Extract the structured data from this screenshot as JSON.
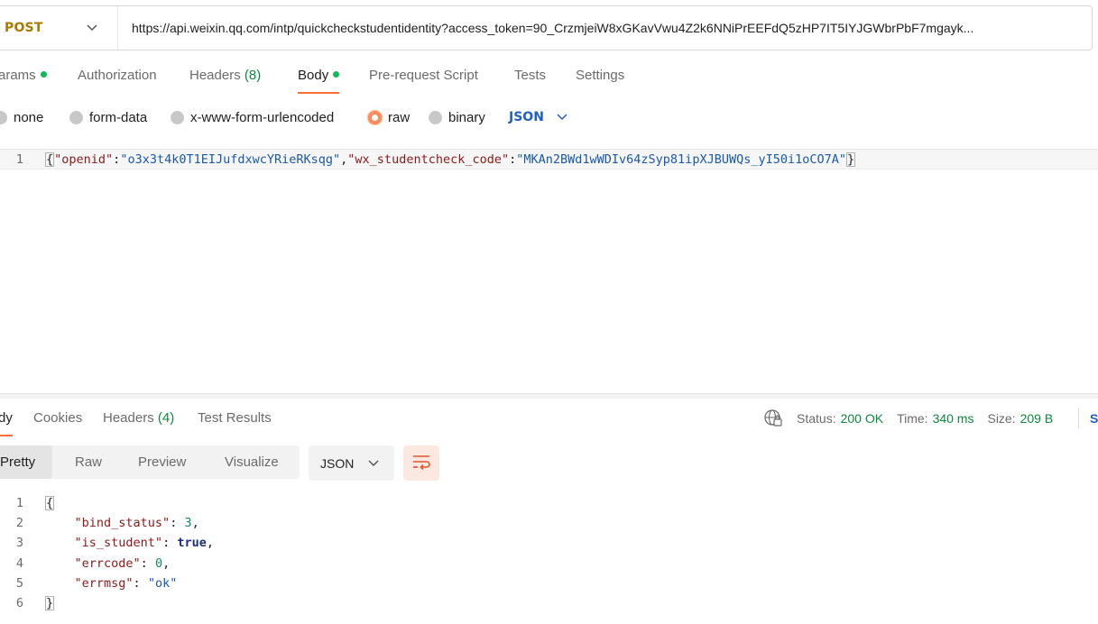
{
  "request": {
    "method": "POST",
    "url": "https://api.weixin.qq.com/intp/quickcheckstudentidentity?access_token=90_CrzmjeiW8xGKavVwu4Z2k6NNiPrEEFdQ5zHP7IT5IYJGWbrPbF7mgayk..."
  },
  "req_tabs": [
    {
      "label": "arams",
      "dot": true
    },
    {
      "label": "Authorization"
    },
    {
      "label": "Headers",
      "count": "(8)"
    },
    {
      "label": "Body",
      "dot": true,
      "active": true
    },
    {
      "label": "Pre-request Script"
    },
    {
      "label": "Tests"
    },
    {
      "label": "Settings"
    }
  ],
  "body_types": [
    {
      "label": "none"
    },
    {
      "label": "form-data"
    },
    {
      "label": "x-www-form-urlencoded"
    },
    {
      "label": "raw",
      "checked": true
    },
    {
      "label": "binary"
    }
  ],
  "body_format": "JSON",
  "request_body": {
    "line_number": "1",
    "open": "{",
    "key1": "\"openid\"",
    "colon": ":",
    "val1": "\"o3x3t4k0T1EIJufdxwcYRieRKsqg\"",
    "comma": ",",
    "key2": "\"wx_studentcheck_code\"",
    "val2": "\"MKAn2BWd1wWDIv64zSyp81ipXJBUWQs_yI50i1oCO7A\"",
    "close": "}"
  },
  "resp_tabs": [
    {
      "label": "dy",
      "active": true
    },
    {
      "label": "Cookies"
    },
    {
      "label": "Headers",
      "count": "(4)"
    },
    {
      "label": "Test Results"
    }
  ],
  "status": {
    "status_label": "Status:",
    "status_value": "200 OK",
    "time_label": "Time:",
    "time_value": "340 ms",
    "size_label": "Size:",
    "size_value": "209 B",
    "save_cut": "S"
  },
  "view_modes": [
    "Pretty",
    "Raw",
    "Preview",
    "Visualize"
  ],
  "response_format": "JSON",
  "response_lines": [
    {
      "n": "1",
      "text": "{"
    },
    {
      "n": "2",
      "key": "\"bind_status\"",
      "sep": ": ",
      "val": "3",
      "type": "num",
      "end": ","
    },
    {
      "n": "3",
      "key": "\"is_student\"",
      "sep": ": ",
      "val": "true",
      "type": "bool",
      "end": ","
    },
    {
      "n": "4",
      "key": "\"errcode\"",
      "sep": ": ",
      "val": "0",
      "type": "num",
      "end": ","
    },
    {
      "n": "5",
      "key": "\"errmsg\"",
      "sep": ": ",
      "val": "\"ok\"",
      "type": "str",
      "end": ""
    },
    {
      "n": "6",
      "text": "}"
    }
  ],
  "colors": {
    "accent": "#ff6c37",
    "method": "#a87a00",
    "success": "#0c8a3e",
    "link": "#1f5ec9"
  }
}
